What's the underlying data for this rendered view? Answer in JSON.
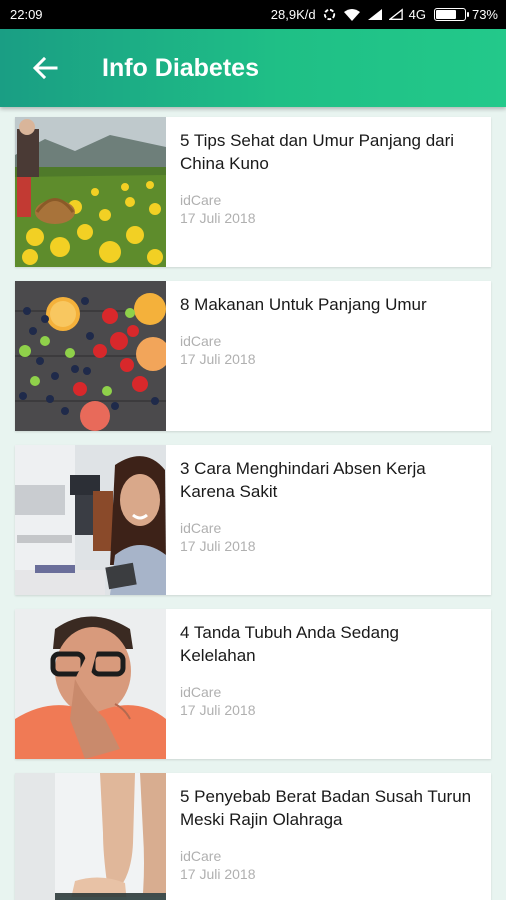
{
  "status_bar": {
    "time": "22:09",
    "speed": "28,9K/d",
    "network": "4G",
    "battery": "73%",
    "battery_level": 0.73
  },
  "app_bar": {
    "title": "Info Diabetes",
    "back_icon": "arrow-left-icon"
  },
  "articles": [
    {
      "title": "5 Tips Sehat dan Umur Panjang dari China Kuno",
      "source": "idCare",
      "date": "17 Juli 2018",
      "image": "flower-field-photo"
    },
    {
      "title": "8 Makanan Untuk Panjang Umur",
      "source": "idCare",
      "date": "17 Juli 2018",
      "image": "fruits-photo"
    },
    {
      "title": "3 Cara Menghindari Absen Kerja Karena Sakit",
      "source": "idCare",
      "date": "17 Juli 2018",
      "image": "office-woman-photo"
    },
    {
      "title": "4 Tanda Tubuh Anda Sedang Kelelahan",
      "source": "idCare",
      "date": "17 Juli 2018",
      "image": "tired-man-photo"
    },
    {
      "title": "5 Penyebab Berat Badan Susah Turun Meski Rajin Olahraga",
      "source": "idCare",
      "date": "17 Juli 2018",
      "image": "feet-scale-photo"
    }
  ],
  "colors": {
    "app_bar_start": "#1a9e84",
    "app_bar_end": "#23c98a",
    "background": "#e8f4f0",
    "meta_text": "#b0b0b0"
  }
}
